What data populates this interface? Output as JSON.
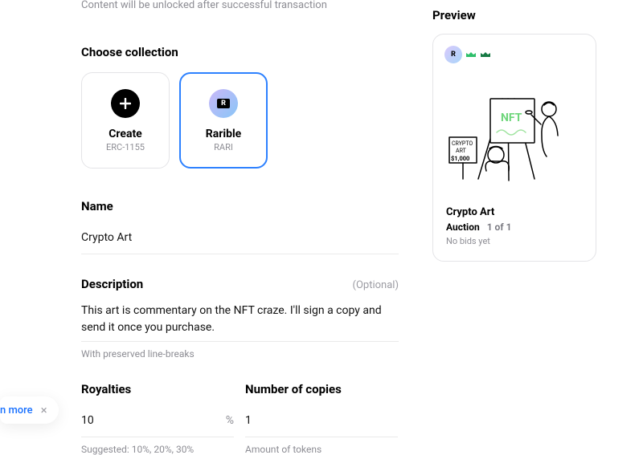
{
  "unlock_note": "Content will be unlocked after successful transaction",
  "choose_collection": {
    "title": "Choose collection",
    "cards": [
      {
        "title": "Create",
        "subtitle": "ERC-1155"
      },
      {
        "title": "Rarible",
        "subtitle": "RARI"
      }
    ]
  },
  "name": {
    "label": "Name",
    "value": "Crypto Art"
  },
  "description": {
    "label": "Description",
    "optional": "(Optional)",
    "value": "This art is commentary on the NFT craze. I'll sign a copy and send it once you purchase.",
    "helper": "With preserved line-breaks"
  },
  "royalties": {
    "label": "Royalties",
    "value": "10",
    "suffix": "%",
    "helper": "Suggested: 10%, 20%, 30%"
  },
  "copies": {
    "label": "Number of copies",
    "value": "1",
    "helper": "Amount of tokens"
  },
  "preview": {
    "title": "Preview",
    "name": "Crypto Art",
    "auction_label": "Auction",
    "edition": "1 of 1",
    "bids": "No bids yet",
    "badge_letter": "R",
    "sign_text": "CRYPTO\nART\n$1,000"
  },
  "toast": {
    "text": "n more",
    "close": "×"
  },
  "colors": {
    "primary": "#2d81ff",
    "muted": "#8d8d94"
  }
}
